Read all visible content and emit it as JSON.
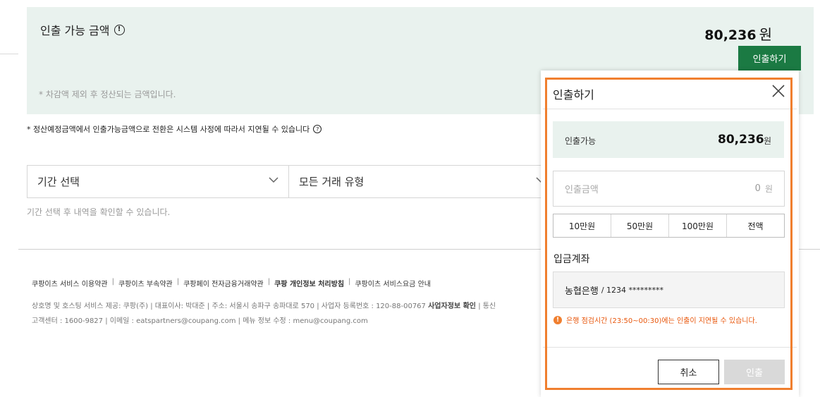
{
  "summary": {
    "title": "인출 가능 금액",
    "info_icon": "info-circle-icon",
    "amount": "80,236",
    "unit": "원",
    "withdraw_button": "인출하기",
    "note": "* 차감액 제외 후 정산되는 금액입니다.",
    "accent_color": "#1b7a43",
    "panel_color": "#e9f2ee"
  },
  "delay_note": "* 정산예정금액에서 인출가능금액으로 전환은 시스템 사정에 따라서 지연될 수 있습니다",
  "filters": {
    "period": "기간 선택",
    "type": "모든 거래 유형",
    "hint": "기간 선택 후 내역을 확인할 수 있습니다."
  },
  "footer": {
    "links": [
      "쿠팡이츠 서비스 이용약관",
      "쿠팡이츠 부속약관",
      "쿠팡페이 전자금융거래약관",
      "쿠팡 개인정보 처리방침",
      "쿠팡이츠 서비스요금 안내"
    ],
    "info_line": "상호명 및 호스팅 서비스 제공: 쿠팡(주)   |   대표이사: 박대준   |   주소: 서울시 송파구 송파대로 570   |   사업자 등록번호 : 120-88-00767",
    "biz_check": "사업자정보 확인",
    "info_tail": "|   통신",
    "contact_line": "고객센터 : 1600-9827   |   이메일 : eatspartners@coupang.com   |   메뉴 정보 수정 : menu@coupang.com"
  },
  "modal": {
    "title": "인출하기",
    "available_label": "인출가능",
    "available_amount": "80,236",
    "unit": "원",
    "input_placeholder": "인출금액",
    "input_value": "0",
    "quick_amounts": [
      "10만원",
      "50만원",
      "100만원",
      "전액"
    ],
    "account_label": "입금계좌",
    "bank": "농협은행",
    "account_number": "/ 1234 *********",
    "warning": "은행 점검시간 (23:50~00:30)에는 인출이 지연될 수 있습니다.",
    "cancel_button": "취소",
    "confirm_button": "인출",
    "highlight_color": "#f07f2f",
    "warning_color": "#e8560b"
  }
}
